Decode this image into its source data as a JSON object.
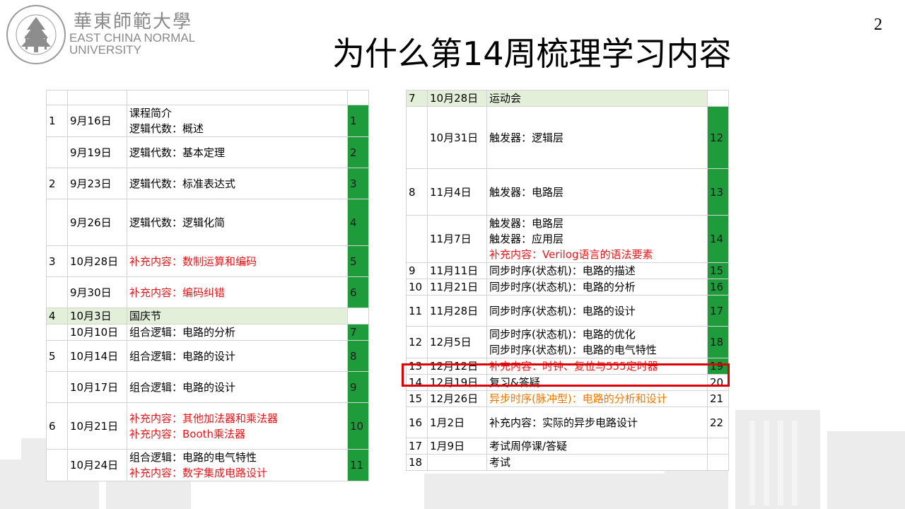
{
  "logo": {
    "cn": "華東師範大學",
    "en_line1": "EAST CHINA NORMAL",
    "en_line2": "UNIVERSITY"
  },
  "page_number": "2",
  "title": "为什么第14周梳理学习内容",
  "left_table": [
    {
      "week": "",
      "date": "",
      "lines": [
        ""
      ],
      "lesson": "",
      "green": false,
      "light": false,
      "h": 21
    },
    {
      "week": "1",
      "date": "9月16日",
      "lines": [
        "课程简介",
        "逻辑代数：概述"
      ],
      "lesson": "1",
      "green": true,
      "h": 44
    },
    {
      "week": "",
      "date": "9月19日",
      "lines": [
        "逻辑代数：基本定理"
      ],
      "lesson": "2",
      "green": true,
      "h": 44
    },
    {
      "week": "2",
      "date": "9月23日",
      "lines": [
        "逻辑代数：标准表达式"
      ],
      "lesson": "3",
      "green": true,
      "h": 44
    },
    {
      "week": "",
      "date": "9月26日",
      "lines": [
        "逻辑代数：逻辑化简"
      ],
      "lesson": "4",
      "green": true,
      "h": 66
    },
    {
      "week": "3",
      "date": "10月28日",
      "lines": [
        "补充内容：数制运算和编码"
      ],
      "lesson": "5",
      "green": true,
      "red": true,
      "h": 44
    },
    {
      "week": "",
      "date": "9月30日",
      "lines": [
        "补充内容：编码纠错"
      ],
      "lesson": "6",
      "green": true,
      "red": true,
      "h": 44
    },
    {
      "week": "4",
      "date": "10月3日",
      "lines": [
        "国庆节"
      ],
      "lesson": "",
      "green": false,
      "light": true,
      "h": 22
    },
    {
      "week": "",
      "date": "10月10日",
      "lines": [
        "组合逻辑：电路的分析"
      ],
      "lesson": "7",
      "green": true,
      "h": 22
    },
    {
      "week": "5",
      "date": "10月14日",
      "lines": [
        "组合逻辑：电路的设计"
      ],
      "lesson": "8",
      "green": true,
      "h": 44
    },
    {
      "week": "",
      "date": "10月17日",
      "lines": [
        "组合逻辑：电路的设计"
      ],
      "lesson": "9",
      "green": true,
      "h": 44
    },
    {
      "week": "6",
      "date": "10月21日",
      "lines": [
        "补充内容：其他加法器和乘法器",
        "补充内容：Booth乘法器"
      ],
      "lesson": "10",
      "green": true,
      "red": true,
      "h": 66
    },
    {
      "week": "",
      "date": "10月24日",
      "lines": [
        "组合逻辑：电路的电气特性",
        "补充内容：数字集成电路设计"
      ],
      "lesson": "11",
      "green": true,
      "red_second": true,
      "h": 44
    }
  ],
  "right_table": [
    {
      "week": "7",
      "date": "10月28日",
      "lines": [
        "运动会"
      ],
      "lesson": "",
      "green": false,
      "light": true,
      "h": 18
    },
    {
      "week": "",
      "date": "10月31日",
      "lines": [
        "触发器：逻辑层"
      ],
      "lesson": "12",
      "green": true,
      "h": 88
    },
    {
      "week": "8",
      "date": "11月4日",
      "lines": [
        "触发器：电路层"
      ],
      "lesson": "13",
      "green": true,
      "h": 66
    },
    {
      "week": "",
      "date": "11月7日",
      "lines": [
        "触发器：电路层",
        "触发器：应用层",
        "补充内容：Verilog语言的语法要素"
      ],
      "lesson": "14",
      "green": true,
      "red_third": true,
      "h": 66
    },
    {
      "week": "9",
      "date": "11月11日",
      "lines": [
        "同步时序(状态机)：电路的描述"
      ],
      "lesson": "15",
      "green": true,
      "h": 22
    },
    {
      "week": "10",
      "date": "11月21日",
      "lines": [
        "同步时序(状态机)：电路的分析"
      ],
      "lesson": "16",
      "green": true,
      "h": 22
    },
    {
      "week": "11",
      "date": "11月28日",
      "lines": [
        "同步时序(状态机)：电路的设计"
      ],
      "lesson": "17",
      "green": true,
      "h": 44
    },
    {
      "week": "12",
      "date": "12月5日",
      "lines": [
        "同步时序(状态机)：电路的优化",
        "同步时序(状态机)：电路的电气特性"
      ],
      "lesson": "18",
      "green": true,
      "h": 44
    },
    {
      "week": "13",
      "date": "12月12日",
      "lines": [
        "补充内容：时钟、复位与555定时器"
      ],
      "lesson": "19",
      "green": true,
      "red": true,
      "h": 22
    },
    {
      "week": "14",
      "date": "12月19日",
      "lines": [
        "复习&答疑"
      ],
      "lesson": "20",
      "green": false,
      "h": 22
    },
    {
      "week": "15",
      "date": "12月26日",
      "lines": [
        "异步时序(脉冲型)：电路的分析和设计"
      ],
      "lesson": "21",
      "green": false,
      "orange": true,
      "h": 22
    },
    {
      "week": "16",
      "date": "1月2日",
      "lines": [
        "补充内容：实际的异步电路设计"
      ],
      "lesson": "22",
      "green": false,
      "h": 44
    },
    {
      "week": "17",
      "date": "1月9日",
      "lines": [
        "考试周停课/答疑"
      ],
      "lesson": "",
      "green": false,
      "h": 22
    },
    {
      "week": "18",
      "date": "",
      "lines": [
        "考试"
      ],
      "lesson": "",
      "green": false,
      "h": 22
    }
  ]
}
